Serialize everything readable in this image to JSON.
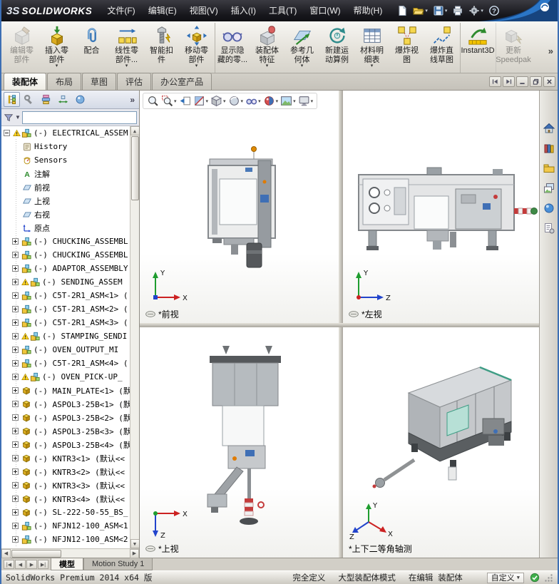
{
  "titlebar": {
    "brand_mark": "3S",
    "brand_name": "SOLIDWORKS",
    "menus": [
      {
        "label": "文件(F)"
      },
      {
        "label": "编辑(E)"
      },
      {
        "label": "视图(V)"
      },
      {
        "label": "插入(I)"
      },
      {
        "label": "工具(T)"
      },
      {
        "label": "窗口(W)"
      },
      {
        "label": "帮助(H)"
      }
    ],
    "quick": [
      {
        "icon": "new-document",
        "cls": ""
      },
      {
        "icon": "open-file",
        "cls": "arrow"
      },
      {
        "icon": "save-file",
        "cls": "arrow"
      },
      {
        "icon": "print",
        "cls": ""
      },
      {
        "icon": "options-gear",
        "cls": "arrow"
      },
      {
        "icon": "help",
        "cls": ""
      }
    ]
  },
  "ribbon": {
    "overflow_label": "»",
    "buttons": [
      {
        "line1": "编辑零",
        "line2": "部件",
        "icon": "edit-component",
        "cls": "disabled"
      },
      {
        "line1": "插入零",
        "line2": "部件",
        "icon": "insert-component",
        "cls": "arrow"
      },
      {
        "line1": "配合",
        "line2": "",
        "icon": "mate",
        "cls": ""
      },
      {
        "line1": "线性零",
        "line2": "部件...",
        "icon": "linear-pattern",
        "cls": "arrow"
      },
      {
        "line1": "智能扣",
        "line2": "件",
        "icon": "smart-fastener",
        "cls": ""
      },
      {
        "line1": "移动零",
        "line2": "部件",
        "icon": "move-component",
        "cls": "arrow"
      },
      {
        "line1": "显示隐",
        "line2": "藏的零...",
        "icon": "show-hidden",
        "cls": "sep"
      },
      {
        "line1": "装配体",
        "line2": "特征",
        "icon": "assembly-feature",
        "cls": "arrow"
      },
      {
        "line1": "参考几",
        "line2": "何体",
        "icon": "reference-geometry",
        "cls": "arrow"
      },
      {
        "line1": "新建运",
        "line2": "动算例",
        "icon": "motion-study",
        "cls": ""
      },
      {
        "line1": "材料明",
        "line2": "细表",
        "icon": "bom",
        "cls": "arrow"
      },
      {
        "line1": "爆炸视",
        "line2": "图",
        "icon": "exploded-view",
        "cls": ""
      },
      {
        "line1": "爆炸直",
        "line2": "线草图",
        "icon": "explode-sketch",
        "cls": ""
      },
      {
        "line1": "Instant3D",
        "line2": "",
        "icon": "instant3d",
        "cls": "sep"
      },
      {
        "line1": "更新",
        "line2": "Speedpak",
        "icon": "speedpak",
        "cls": "sep disabled"
      }
    ]
  },
  "cmdtabs": {
    "items": [
      {
        "label": "装配体",
        "cls": "active"
      },
      {
        "label": "布局",
        "cls": ""
      },
      {
        "label": "草图",
        "cls": ""
      },
      {
        "label": "评估",
        "cls": ""
      },
      {
        "label": "办公室产品",
        "cls": ""
      }
    ]
  },
  "panel": {
    "expand_label": "»",
    "fmtabs": [
      {
        "icon": "featuremanager",
        "cls": "sel"
      },
      {
        "icon": "propertymanager",
        "cls": ""
      },
      {
        "icon": "configurationmanager",
        "cls": ""
      },
      {
        "icon": "dimxpertmanager",
        "cls": ""
      },
      {
        "icon": "displaymanager",
        "cls": ""
      }
    ],
    "filter_value": "",
    "tree": [
      {
        "label": "(-) ELECTRICAL_ASSEM",
        "icon": "assembly",
        "cls": "lvl0 warn box-minus"
      },
      {
        "label": "History",
        "icon": "history",
        "cls": "sub"
      },
      {
        "label": "Sensors",
        "icon": "sensors",
        "cls": "sub"
      },
      {
        "label": "注解",
        "icon": "annotations",
        "cls": "sub"
      },
      {
        "label": "前视",
        "icon": "plane",
        "cls": "sub"
      },
      {
        "label": "上视",
        "icon": "plane",
        "cls": "sub"
      },
      {
        "label": "右视",
        "icon": "plane",
        "cls": "sub"
      },
      {
        "label": "原点",
        "icon": "origin",
        "cls": "sub"
      },
      {
        "label": "(-) CHUCKING_ASSEMBL",
        "icon": "assembly",
        "cls": "lvl1 box-plus"
      },
      {
        "label": "(-) CHUCKING_ASSEMBL",
        "icon": "assembly",
        "cls": "lvl1 box-plus"
      },
      {
        "label": "(-) ADAPTOR_ASSEMBLY",
        "icon": "assembly",
        "cls": "lvl1 box-plus"
      },
      {
        "label": "(-) SENDING_ASSEM",
        "icon": "assembly",
        "cls": "lvl1 warn box-plus"
      },
      {
        "label": "(-) C5T-2R1_ASM<1> (",
        "icon": "assembly",
        "cls": "lvl1 box-plus"
      },
      {
        "label": "(-) C5T-2R1_ASM<2> (",
        "icon": "assembly",
        "cls": "lvl1 box-plus"
      },
      {
        "label": "(-) C5T-2R1_ASM<3> (",
        "icon": "assembly",
        "cls": "lvl1 box-plus"
      },
      {
        "label": "(-) STAMPING_SENDI",
        "icon": "assembly",
        "cls": "lvl1 warn box-plus"
      },
      {
        "label": "(-) OVEN_OUTPUT_MI",
        "icon": "assembly",
        "cls": "lvl1 box-plus"
      },
      {
        "label": "(-) C5T-2R1_ASM<4> (",
        "icon": "assembly",
        "cls": "lvl1 box-plus"
      },
      {
        "label": "(-) OVEN_PICK-UP_",
        "icon": "assembly",
        "cls": "lvl1 warn box-plus"
      },
      {
        "label": "(-) MAIN_PLATE<1> (默",
        "icon": "part",
        "cls": "lvl1 box-plus"
      },
      {
        "label": "(-) ASPOL3-25B<1> (默",
        "icon": "part",
        "cls": "lvl1 box-plus"
      },
      {
        "label": "(-) ASPOL3-25B<2> (默",
        "icon": "part",
        "cls": "lvl1 box-plus"
      },
      {
        "label": "(-) ASPOL3-25B<3> (默",
        "icon": "part",
        "cls": "lvl1 box-plus"
      },
      {
        "label": "(-) ASPOL3-25B<4> (默",
        "icon": "part",
        "cls": "lvl1 box-plus"
      },
      {
        "label": "(-) KNTR3<1> (默认<<",
        "icon": "part",
        "cls": "lvl1 box-plus"
      },
      {
        "label": "(-) KNTR3<2> (默认<<",
        "icon": "part",
        "cls": "lvl1 box-plus"
      },
      {
        "label": "(-) KNTR3<3> (默认<<",
        "icon": "part",
        "cls": "lvl1 box-plus"
      },
      {
        "label": "(-) KNTR3<4> (默认<<",
        "icon": "part",
        "cls": "lvl1 box-plus"
      },
      {
        "label": "(-) SL-222-50-55_BS_",
        "icon": "part",
        "cls": "lvl1 box-plus"
      },
      {
        "label": "(-) NFJN12-100_ASM<1",
        "icon": "assembly",
        "cls": "lvl1 box-plus"
      },
      {
        "label": "(-) NFJN12-100_ASM<2",
        "icon": "assembly",
        "cls": "lvl1 box-plus"
      }
    ]
  },
  "headsup": [
    {
      "icon": "zoom-fit",
      "cls": ""
    },
    {
      "icon": "zoom-area",
      "cls": "arrow"
    },
    {
      "icon": "previous-view",
      "cls": ""
    },
    {
      "icon": "section-view",
      "cls": "arrow"
    },
    {
      "icon": "view-orientation",
      "cls": "arrow"
    },
    {
      "icon": "display-style",
      "cls": "arrow"
    },
    {
      "icon": "hide-show-items",
      "cls": "arrow"
    },
    {
      "icon": "edit-appearance",
      "cls": "arrow"
    },
    {
      "icon": "apply-scene",
      "cls": "arrow"
    },
    {
      "icon": "view-settings",
      "cls": "arrow"
    }
  ],
  "viewports": [
    {
      "label": "*前视",
      "triad": {
        "up": "Y",
        "right": "X"
      }
    },
    {
      "label": "*左视",
      "triad": {
        "up": "Y",
        "right": "Z"
      }
    },
    {
      "label": "*上视",
      "triad": {
        "right": "X",
        "down": "Z"
      }
    },
    {
      "label": "*上下二等角轴测",
      "triad": {
        "up": "Y",
        "right": "X",
        "left": "Z"
      }
    }
  ],
  "taskpane": [
    {
      "icon": "resources-home"
    },
    {
      "icon": "design-library"
    },
    {
      "icon": "file-explorer"
    },
    {
      "icon": "view-palette"
    },
    {
      "icon": "appearances"
    },
    {
      "icon": "custom-properties"
    }
  ],
  "doctabs": {
    "nav": [
      "|◀",
      "◀",
      "▶",
      "▶|"
    ],
    "tabs": [
      {
        "label": "模型",
        "cls": "active"
      },
      {
        "label": "Motion Study 1",
        "cls": ""
      }
    ]
  },
  "statusbar": {
    "left": "SolidWorks Premium 2014 x64 版",
    "defined": "完全定义",
    "mode": "大型装配体模式",
    "editing": "在编辑 装配体",
    "custom": "自定义"
  },
  "icons": {
    "filter": "funnel-icon",
    "status_check": "check-circle-icon",
    "view_indicator": "view-orientation-oval-icon",
    "brand_swoosh": "solidworks-swoosh-graphic"
  }
}
